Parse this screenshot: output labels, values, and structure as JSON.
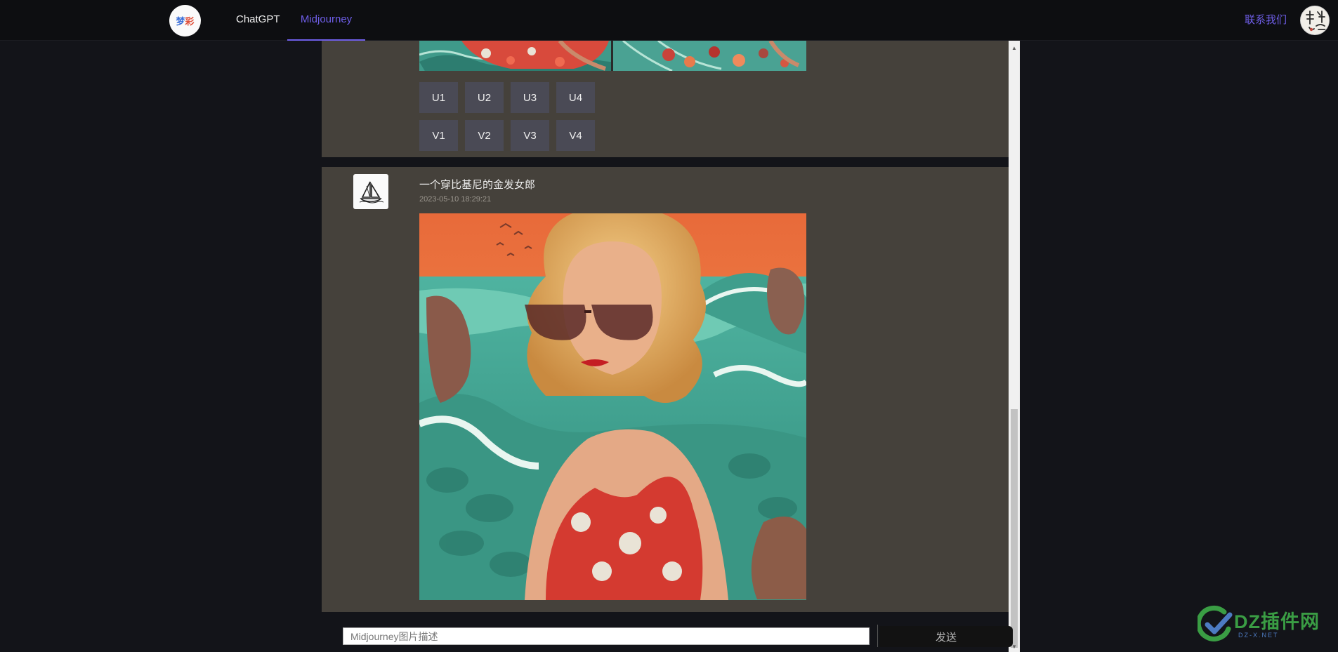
{
  "nav": {
    "logo_text_1": "梦",
    "logo_text_2": "彩",
    "items": [
      {
        "label": "ChatGPT",
        "active": false
      },
      {
        "label": "Midjourney",
        "active": true
      }
    ],
    "contact_label": "联系我们",
    "accent_color": "#6e5ee8"
  },
  "previous_message": {
    "upscale_buttons": [
      "U1",
      "U2",
      "U3",
      "U4"
    ],
    "variation_buttons": [
      "V1",
      "V2",
      "V3",
      "V4"
    ]
  },
  "current_message": {
    "bot_icon": "sailboat-icon",
    "prompt_text": "一个穿比基尼的金发女郎",
    "timestamp": "2023-05-10 18:29:21"
  },
  "composer": {
    "placeholder": "Midjourney图片描述",
    "value": "",
    "send_label": "发送"
  },
  "watermark": {
    "text": "DZ插件网",
    "subtext": "DZ-X.NET"
  }
}
